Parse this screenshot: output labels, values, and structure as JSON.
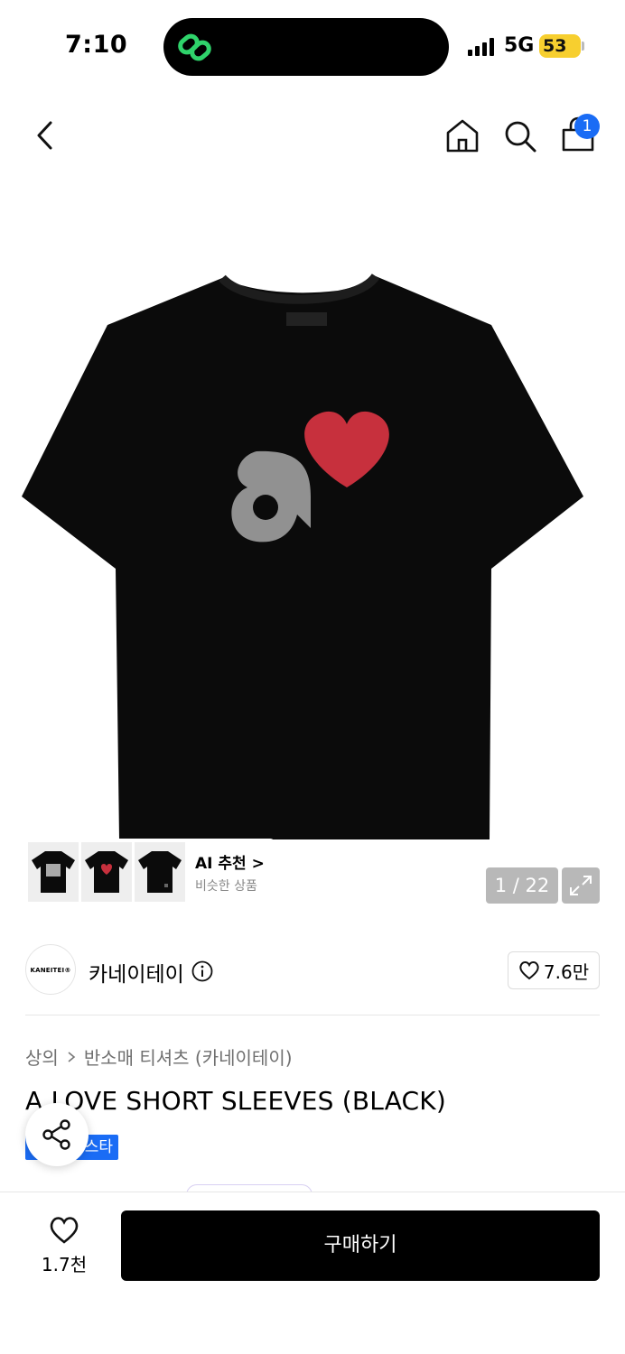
{
  "status_bar": {
    "time": "7:10",
    "network": "5G",
    "battery": "53"
  },
  "header": {
    "back_icon": "chevron-left-icon",
    "home_icon": "home-icon",
    "search_icon": "search-icon",
    "cart_icon": "shopping-bag-icon",
    "cart_badge": "1",
    "badge_color": "#1a6cf5"
  },
  "gallery": {
    "ai_recommend": {
      "title": "AI 추천 >",
      "subtitle": "비슷한 상품"
    },
    "page_counter": "1 / 22",
    "expand_icon": "expand-icon"
  },
  "brand": {
    "logo_text": "KANEITEI®",
    "name": "카네이테이",
    "likes": "7.6만"
  },
  "product": {
    "breadcrumb": [
      "상의",
      "반소매 티셔츠 (카네이테이)"
    ],
    "title": "A LOVE SHORT SLEEVES (BLACK)",
    "tag": "스타"
  },
  "bottom_bar": {
    "wish_count": "1.7천",
    "buy_label": "구매하기"
  }
}
